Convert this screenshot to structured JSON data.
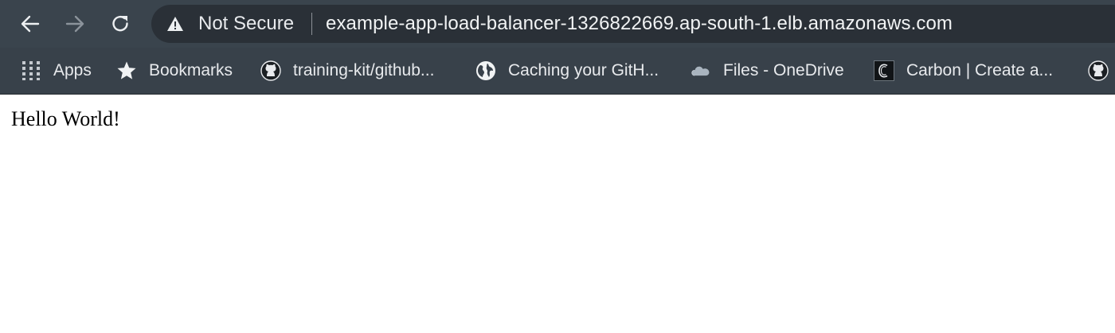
{
  "browser": {
    "colors": {
      "toolbar": "#3a444d",
      "bookmarks_bar": "#38414a",
      "omnibox": "#2a3037",
      "text": "#e8eaed"
    },
    "nav": {
      "back_icon": "arrow-left-icon",
      "forward_icon": "arrow-right-icon",
      "reload_icon": "reload-icon"
    },
    "omnibox": {
      "security_icon": "warning-triangle-icon",
      "security_label": "Not Secure",
      "url": "example-app-load-balancer-1326822669.ap-south-1.elb.amazonaws.com"
    },
    "bookmarks": [
      {
        "label": "Apps",
        "icon": "apps-grid-icon"
      },
      {
        "label": "Bookmarks",
        "icon": "star-icon"
      },
      {
        "label": "training-kit/github...",
        "icon": "github-icon"
      },
      {
        "label": "Caching your GitH...",
        "icon": "globe-icon"
      },
      {
        "label": "Files - OneDrive",
        "icon": "onedrive-cloud-icon"
      },
      {
        "label": "Carbon | Create a...",
        "icon": "carbon-icon"
      },
      {
        "label": "",
        "icon": "github-icon"
      }
    ]
  },
  "page": {
    "body_text": "Hello World!"
  }
}
